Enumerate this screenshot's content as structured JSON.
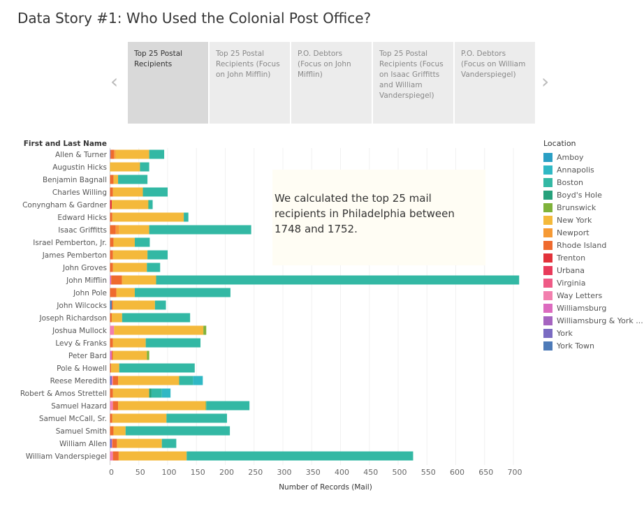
{
  "title": "Data Story #1: Who Used the Colonial Post Office?",
  "story_tabs": [
    {
      "label": "Top 25 Postal Recipients",
      "active": true
    },
    {
      "label": "Top 25 Postal Recipients (Focus on John Mifflin)"
    },
    {
      "label": "P.O. Debtors (Focus on John Mifflin)"
    },
    {
      "label": "Top 25 Postal Recipients (Focus on Isaac Griffitts and William Vanderspiegel)"
    },
    {
      "label": "P.O. Debtors (Focus on William Vanderspiegel)"
    }
  ],
  "nav": {
    "prev_icon": "chevron-left-icon",
    "next_icon": "chevron-right-icon"
  },
  "annotation": "We calculated the top 25 mail recipients in Philadelphia between 1748 and 1752.",
  "legend": {
    "title": "Location",
    "items": [
      {
        "name": "Amboy",
        "color": "#2a9fc4"
      },
      {
        "name": "Annapolis",
        "color": "#2fb8c4"
      },
      {
        "name": "Boston",
        "color": "#33b8a4"
      },
      {
        "name": "Boyd's Hole",
        "color": "#26a17b"
      },
      {
        "name": "Brunswick",
        "color": "#7fb23a"
      },
      {
        "name": "New York",
        "color": "#f4b93b"
      },
      {
        "name": "Newport",
        "color": "#f69a35"
      },
      {
        "name": "Rhode Island",
        "color": "#ef6a2e"
      },
      {
        "name": "Trenton",
        "color": "#e2323a"
      },
      {
        "name": "Urbana",
        "color": "#e83a5a"
      },
      {
        "name": "Virginia",
        "color": "#ef5a86"
      },
      {
        "name": "Way Letters",
        "color": "#f27fae"
      },
      {
        "name": "Williamsburg",
        "color": "#dc6bbf"
      },
      {
        "name": "Williamsburg & York ...",
        "color": "#a564c0"
      },
      {
        "name": "York",
        "color": "#7a6bc2"
      },
      {
        "name": "York Town",
        "color": "#4d7ab8"
      }
    ]
  },
  "chart_data": {
    "type": "bar",
    "orientation": "horizontal",
    "stacked": true,
    "ylabel": "First and Last Name",
    "xlabel": "Number of Records (Mail)",
    "xlim": [
      0,
      750
    ],
    "xticks": [
      0,
      50,
      100,
      150,
      200,
      250,
      300,
      350,
      400,
      450,
      500,
      550,
      600,
      650,
      700
    ],
    "grid": "vertical",
    "legend_placement": "right",
    "rows": [
      {
        "name": "Allen & Turner",
        "segments": [
          [
            "York",
            1
          ],
          [
            "Rhode Island",
            6
          ],
          [
            "Newport",
            3
          ],
          [
            "New York",
            58
          ],
          [
            "Boston",
            26
          ]
        ]
      },
      {
        "name": "Augustin Hicks",
        "segments": [
          [
            "New York",
            52
          ],
          [
            "Boston",
            16
          ]
        ]
      },
      {
        "name": "Benjamin Bagnall",
        "segments": [
          [
            "Rhode Island",
            6
          ],
          [
            "New York",
            8
          ],
          [
            "Boston",
            51
          ]
        ]
      },
      {
        "name": "Charles Willing",
        "segments": [
          [
            "Rhode Island",
            5
          ],
          [
            "New York",
            52
          ],
          [
            "Boston",
            43
          ]
        ]
      },
      {
        "name": "Conyngham & Gardner",
        "segments": [
          [
            "Trenton",
            3
          ],
          [
            "New York",
            63
          ],
          [
            "Brunswick",
            1
          ],
          [
            "Boston",
            7
          ]
        ]
      },
      {
        "name": "Edward Hicks",
        "segments": [
          [
            "Rhode Island",
            4
          ],
          [
            "New York",
            124
          ],
          [
            "Boston",
            8
          ]
        ]
      },
      {
        "name": "Isaac Griffitts",
        "segments": [
          [
            "Rhode Island",
            10
          ],
          [
            "Newport",
            6
          ],
          [
            "New York",
            52
          ],
          [
            "Boston",
            177
          ]
        ]
      },
      {
        "name": "Israel Pemberton, Jr.",
        "segments": [
          [
            "Rhode Island",
            6
          ],
          [
            "New York",
            37
          ],
          [
            "Boston",
            26
          ]
        ]
      },
      {
        "name": "James Pemberton",
        "segments": [
          [
            "Rhode Island",
            5
          ],
          [
            "New York",
            60
          ],
          [
            "Boston",
            35
          ]
        ]
      },
      {
        "name": "John Groves",
        "segments": [
          [
            "Rhode Island",
            5
          ],
          [
            "New York",
            59
          ],
          [
            "Boston",
            23
          ]
        ]
      },
      {
        "name": "John Mifflin",
        "segments": [
          [
            "Williamsburg",
            2
          ],
          [
            "Rhode Island",
            18
          ],
          [
            "Newport",
            2
          ],
          [
            "New York",
            58
          ],
          [
            "Boston",
            630
          ]
        ]
      },
      {
        "name": "John Pole",
        "segments": [
          [
            "Rhode Island",
            11
          ],
          [
            "New York",
            32
          ],
          [
            "Boston",
            166
          ]
        ]
      },
      {
        "name": "John Wilcocks",
        "segments": [
          [
            "York Town",
            3
          ],
          [
            "Rhode Island",
            2
          ],
          [
            "New York",
            73
          ],
          [
            "Boston",
            19
          ]
        ]
      },
      {
        "name": "Joseph Richardson",
        "segments": [
          [
            "Rhode Island",
            3
          ],
          [
            "New York",
            18
          ],
          [
            "Boston",
            118
          ]
        ]
      },
      {
        "name": "Joshua Mullock",
        "segments": [
          [
            "Way Letters",
            7
          ],
          [
            "New York",
            155
          ],
          [
            "Brunswick",
            5
          ]
        ]
      },
      {
        "name": "Levy & Franks",
        "segments": [
          [
            "Rhode Island",
            5
          ],
          [
            "New York",
            57
          ],
          [
            "Boston",
            95
          ]
        ]
      },
      {
        "name": "Peter Bard",
        "segments": [
          [
            "Williamsburg",
            3
          ],
          [
            "Rhode Island",
            2
          ],
          [
            "New York",
            59
          ],
          [
            "Brunswick",
            4
          ]
        ]
      },
      {
        "name": "Pole & Howell",
        "segments": [
          [
            "Rhode Island",
            2
          ],
          [
            "New York",
            14
          ],
          [
            "Boston",
            131
          ]
        ]
      },
      {
        "name": "Reese Meredith",
        "segments": [
          [
            "York",
            3
          ],
          [
            "Way Letters",
            2
          ],
          [
            "Rhode Island",
            9
          ],
          [
            "New York",
            106
          ],
          [
            "Boston",
            24
          ],
          [
            "Annapolis",
            17
          ]
        ]
      },
      {
        "name": "Robert & Amos Strettell",
        "segments": [
          [
            "Rhode Island",
            5
          ],
          [
            "New York",
            63
          ],
          [
            "Boyd's Hole",
            4
          ],
          [
            "Boston",
            18
          ],
          [
            "Annapolis",
            15
          ]
        ]
      },
      {
        "name": "Samuel Hazard",
        "segments": [
          [
            "Way Letters",
            5
          ],
          [
            "Rhode Island",
            9
          ],
          [
            "New York",
            152
          ],
          [
            "Brunswick",
            1
          ],
          [
            "Boston",
            75
          ]
        ]
      },
      {
        "name": "Samuel McCall, Sr.",
        "segments": [
          [
            "Rhode Island",
            4
          ],
          [
            "New York",
            94
          ],
          [
            "Boston",
            105
          ]
        ]
      },
      {
        "name": "Samuel Smith",
        "segments": [
          [
            "Rhode Island",
            6
          ],
          [
            "New York",
            21
          ],
          [
            "Boston",
            181
          ]
        ]
      },
      {
        "name": "William Allen",
        "segments": [
          [
            "York",
            3
          ],
          [
            "Way Letters",
            1
          ],
          [
            "Rhode Island",
            8
          ],
          [
            "New York",
            78
          ],
          [
            "Boston",
            25
          ]
        ]
      },
      {
        "name": "William Vanderspiegel",
        "segments": [
          [
            "Way Letters",
            5
          ],
          [
            "Rhode Island",
            10
          ],
          [
            "New York",
            118
          ],
          [
            "Boston",
            393
          ]
        ]
      }
    ]
  }
}
